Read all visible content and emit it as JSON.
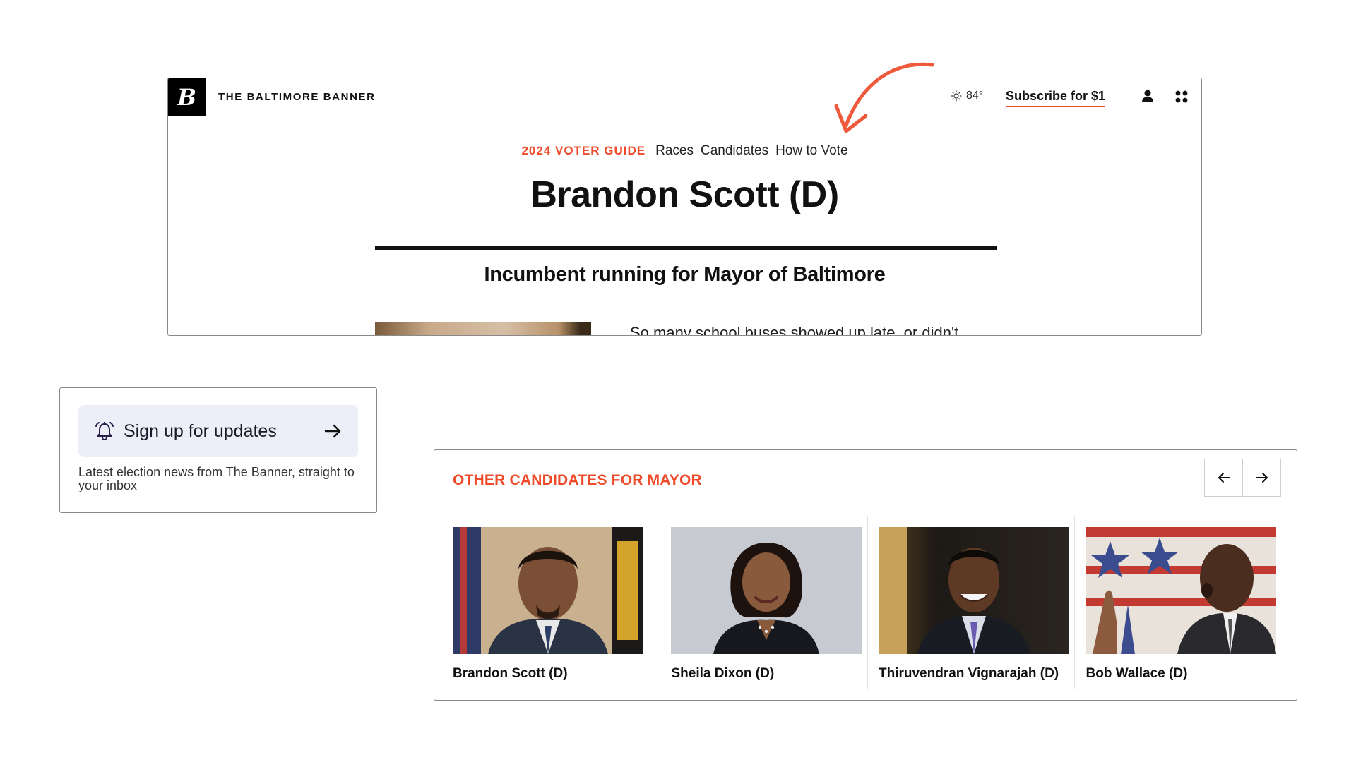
{
  "header": {
    "brand": "THE BALTIMORE BANNER",
    "logo_letter": "B",
    "weather_icon": "sun-icon",
    "temperature": "84°",
    "subscribe_label": "Subscribe for $1",
    "user_icon": "user-icon",
    "menu_icon": "grid-menu-icon"
  },
  "subnav": {
    "guide_label": "2024 VOTER GUIDE",
    "links": [
      "Races",
      "Candidates",
      "How to Vote"
    ]
  },
  "article": {
    "title": "Brandon Scott (D)",
    "dek": "Incumbent running for Mayor of Baltimore",
    "body_snippet": "So many school buses showed up late, or didn't"
  },
  "signup": {
    "button_label": "Sign up for updates",
    "description": "Latest election news from The Banner, straight to your inbox",
    "bell_icon": "bell-icon",
    "arrow_icon": "arrow-right-icon"
  },
  "others": {
    "title": "OTHER CANDIDATES FOR MAYOR",
    "prev_icon": "arrow-left-icon",
    "next_icon": "arrow-right-icon",
    "candidates": [
      {
        "name": "Brandon Scott (D)"
      },
      {
        "name": "Sheila Dixon (D)"
      },
      {
        "name": "Thiruvendran Vignarajah (D)"
      },
      {
        "name": "Bob Wallace (D)"
      }
    ]
  },
  "colors": {
    "accent": "#ef4b2b",
    "signup_bg": "#eceff7",
    "border": "#8a8a8a"
  }
}
